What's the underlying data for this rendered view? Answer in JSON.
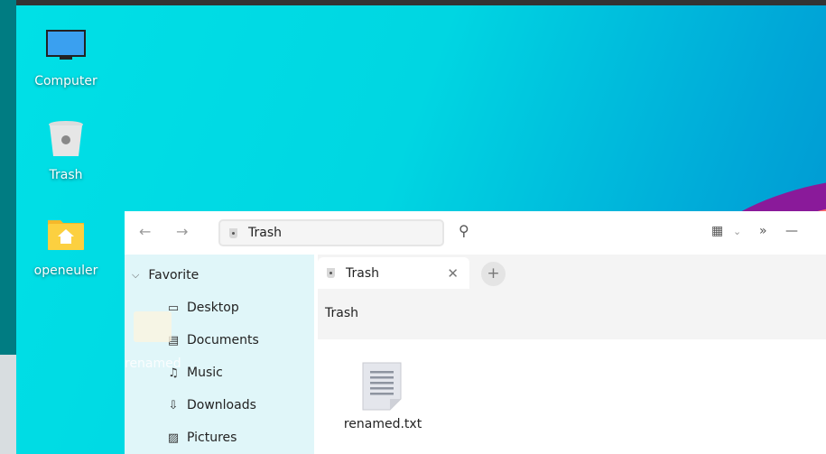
{
  "desktop": {
    "icons": [
      {
        "label": "Computer"
      },
      {
        "label": "Trash"
      },
      {
        "label": "openeuler"
      }
    ],
    "dragged_item": "renamed"
  },
  "window": {
    "address": "Trash",
    "sidebar": {
      "section": "Favorite",
      "items": [
        {
          "label": "Desktop",
          "icon": "monitor-icon"
        },
        {
          "label": "Documents",
          "icon": "document-icon"
        },
        {
          "label": "Music",
          "icon": "music-icon"
        },
        {
          "label": "Downloads",
          "icon": "download-icon"
        },
        {
          "label": "Pictures",
          "icon": "picture-icon"
        }
      ]
    },
    "tab": {
      "label": "Trash"
    },
    "breadcrumb": "Trash",
    "files": [
      {
        "name": "renamed.txt"
      }
    ]
  }
}
